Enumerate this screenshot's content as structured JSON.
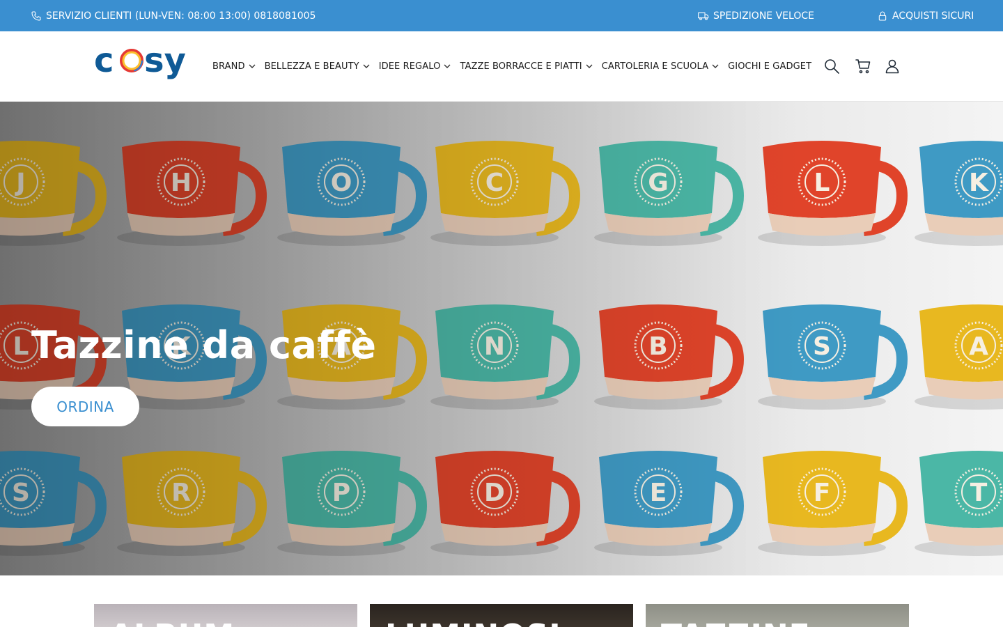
{
  "topbar": {
    "phone_text": "SERVIZIO CLIENTI (LUN-VEN: 08:00 13:00) 0818081005",
    "shipping_text": "SPEDIZIONE VELOCE",
    "secure_text": "ACQUISTI SICURI",
    "background": "#3a8fd0"
  },
  "header": {
    "logo_text": "cosy",
    "nav": [
      {
        "label": "BRAND",
        "dropdown": true
      },
      {
        "label": "BELLEZZA E BEAUTY",
        "dropdown": true
      },
      {
        "label": "IDEE REGALO",
        "dropdown": true
      },
      {
        "label": "TAZZE BORRACCE E PIATTI",
        "dropdown": true
      },
      {
        "label": "CARTOLERIA E SCUOLA",
        "dropdown": true
      },
      {
        "label": "GIOCHI E GADGET",
        "dropdown": false
      }
    ],
    "icons": [
      "search-icon",
      "cart-icon",
      "user-icon"
    ]
  },
  "hero": {
    "title": "Tazzine da caffè",
    "button_label": "ORDINA",
    "mug_rows": [
      {
        "letters": [
          "J",
          "H",
          "O",
          "C",
          "G",
          "L",
          "K"
        ],
        "colors": [
          "#e8b820",
          "#e0442a",
          "#3f9ac4",
          "#e8b820",
          "#4bb7a6",
          "#e0442a",
          "#3f9ac4"
        ]
      },
      {
        "letters": [
          "L",
          "K",
          "A",
          "N",
          "B",
          "S",
          "A"
        ],
        "colors": [
          "#e0442a",
          "#3f9ac4",
          "#e8b820",
          "#4bb7a6",
          "#e0442a",
          "#3f9ac4",
          "#e8b820"
        ]
      },
      {
        "letters": [
          "S",
          "R",
          "P",
          "D",
          "E",
          "F",
          "T"
        ],
        "colors": [
          "#3f9ac4",
          "#e8b820",
          "#4bb7a6",
          "#e0442a",
          "#3f9ac4",
          "#e8b820",
          "#4bb7a6"
        ]
      }
    ]
  },
  "tiles": [
    {
      "label": "ALBUM"
    },
    {
      "label": "LUMINOSI"
    },
    {
      "label": "TAZZINE"
    }
  ]
}
